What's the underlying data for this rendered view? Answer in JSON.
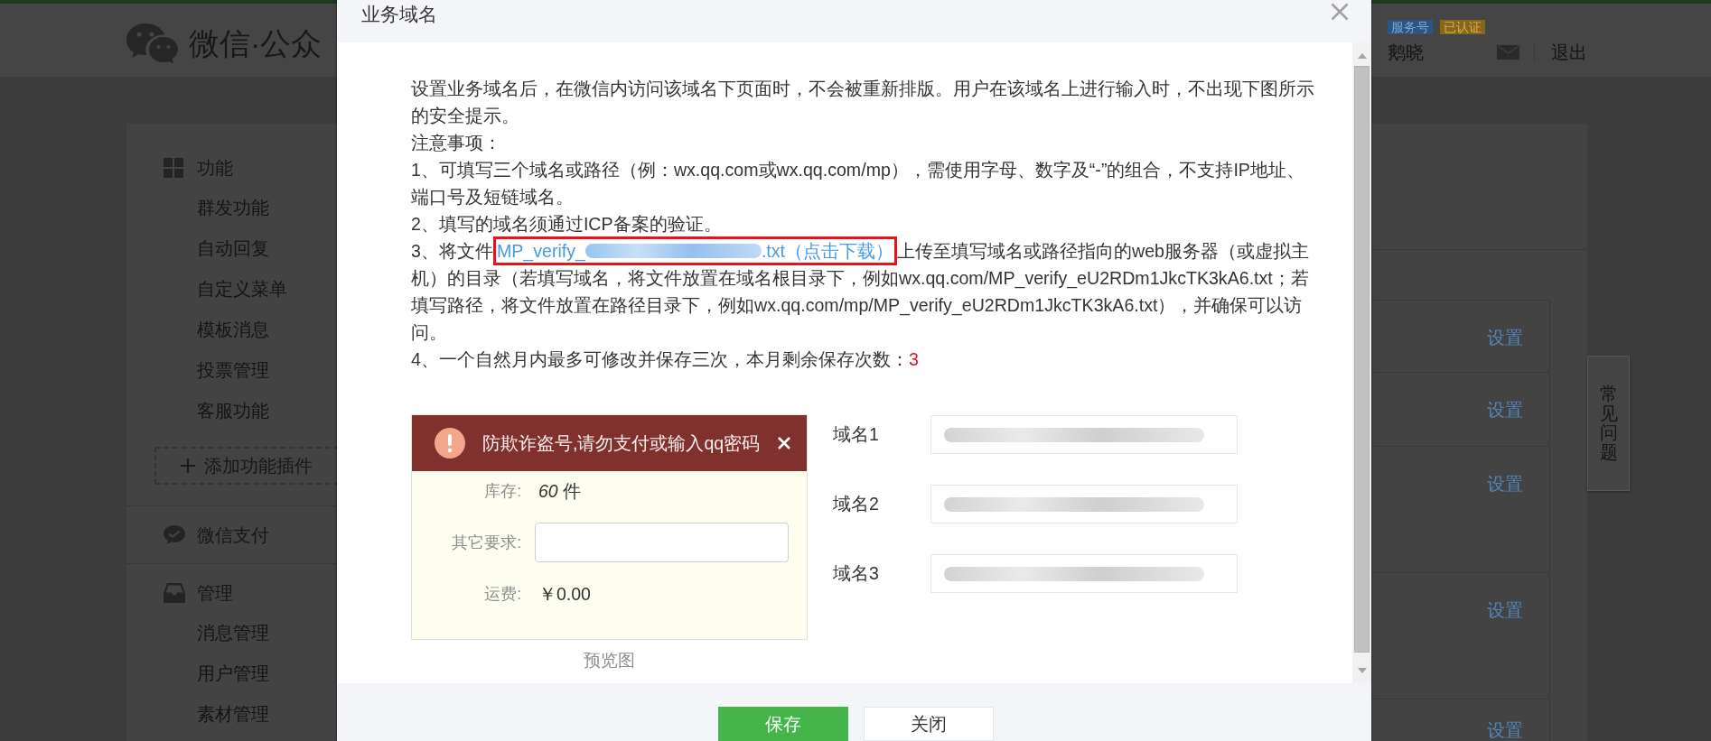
{
  "page": {
    "brand": "微信·公众",
    "badges": [
      {
        "label": "服务号",
        "kind": "account"
      },
      {
        "label": "已认证",
        "kind": "verified"
      }
    ],
    "user": "鹅晓",
    "logout": "退出",
    "sidebar": [
      {
        "kind": "features",
        "title": "功能",
        "items": [
          "群发功能",
          "自动回复",
          "自定义菜单",
          "模板消息",
          "投票管理",
          "客服功能"
        ],
        "add_button": "添加功能插件"
      },
      {
        "kind": "payment",
        "title": "微信支付"
      },
      {
        "kind": "management",
        "title": "管理",
        "items": [
          "消息管理",
          "用户管理",
          "素材管理"
        ]
      }
    ],
    "rows": [
      {
        "action": "设置"
      },
      {
        "action": "设置"
      },
      {
        "action": "设置"
      },
      {
        "action": "设置"
      },
      {
        "action": "设置"
      }
    ],
    "help_tab": "常见问题"
  },
  "dialog": {
    "title": "业务域名",
    "paragraphs": [
      {
        "kind": "text",
        "text": "设置业务域名后，在微信内访问该域名下页面时，不会被重新排版。用户在该域名上进行输入时，不出现下图所示的安全提示。"
      },
      {
        "kind": "text",
        "text": "注意事项："
      },
      {
        "kind": "text",
        "text": "1、可填写三个域名或路径（例：wx.qq.com或wx.qq.com/mp），需使用字母、数字及“-”的组合，不支持IP地址、端口号及短链域名。"
      },
      {
        "kind": "text",
        "text": "2、填写的域名须通过ICP备案的验证。"
      },
      {
        "kind": "file",
        "before": "3、将文件",
        "link": {
          "start": "MP_verify_",
          "end": ".txt（点击下载）",
          "highlighted": true
        },
        "after": "上传至填写域名或路径指向的web服务器（或虚拟主机）的目录（若填写域名，将文件放置在域名根目录下，例如wx.qq.com/MP_verify_eU2RDm1JkcTK3kA6.txt；若填写路径，将文件放置在路径目录下，例如wx.qq.com/mp/MP_verify_eU2RDm1JkcTK3kA6.txt），并确保可以访问。"
      },
      {
        "kind": "count",
        "text": "4、一个自然月内最多可修改并保存三次，本月剩余保存次数：",
        "count": "3"
      }
    ],
    "preview": {
      "warning": "防欺诈盗号,请勿支付或输入qq密码",
      "rows": [
        {
          "kind": "value",
          "label": "库存:",
          "value": "*60* 件"
        },
        {
          "kind": "input",
          "label": "其它要求:"
        },
        {
          "kind": "value",
          "label": "运费:",
          "value": "￥0.00"
        }
      ],
      "caption": "预览图"
    },
    "domains": [
      {
        "label": "域名1",
        "blurred": true
      },
      {
        "label": "域名2",
        "blurred": true
      },
      {
        "label": "域名3",
        "blurred": true
      }
    ],
    "buttons": [
      {
        "label": "保存",
        "kind": "primary"
      },
      {
        "label": "关闭",
        "kind": "secondary"
      }
    ]
  }
}
